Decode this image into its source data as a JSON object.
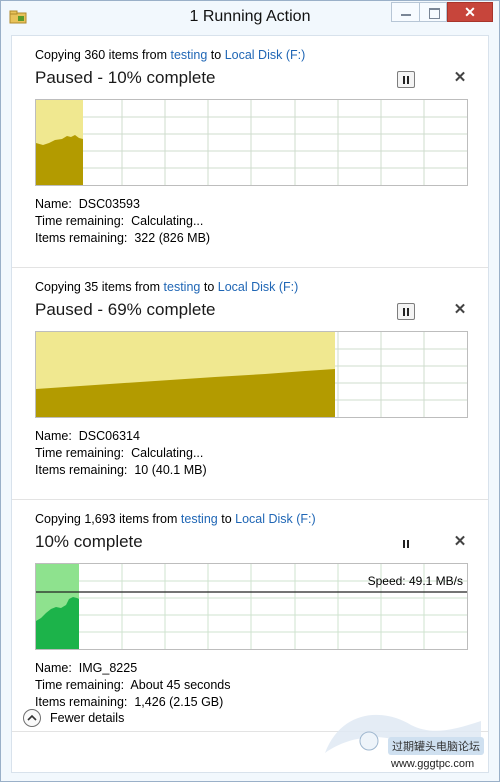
{
  "window": {
    "title": "1 Running Action",
    "close_glyph": "✕"
  },
  "colors": {
    "accent_link": "#1f66b5",
    "paused_fill": "#f0e890",
    "paused_bar": "#b39b00",
    "active_fill": "#8ee28e",
    "active_bar": "#1cb34a",
    "grid": "#cfdcce"
  },
  "operations": [
    {
      "prefix": "Copying 360 items from ",
      "source": "testing",
      "mid": " to ",
      "dest": "Local Disk (F:)",
      "status": "Paused - 10% complete",
      "progress": 0.1,
      "state": "paused",
      "pause_icon": "pause-icon",
      "cancel_glyph": "✕",
      "name_label": "Name:",
      "name_value": "DSC03593",
      "time_label": "Time remaining:",
      "time_value": "Calculating...",
      "items_label": "Items remaining:",
      "items_value": "322 (826 MB)"
    },
    {
      "prefix": "Copying 35 items from ",
      "source": "testing",
      "mid": " to ",
      "dest": "Local Disk (F:)",
      "status": "Paused - 69% complete",
      "progress": 0.69,
      "state": "paused",
      "pause_icon": "pause-icon",
      "cancel_glyph": "✕",
      "name_label": "Name:",
      "name_value": "DSC06314",
      "time_label": "Time remaining:",
      "time_value": "Calculating...",
      "items_label": "Items remaining:",
      "items_value": "10 (40.1 MB)"
    },
    {
      "prefix": "Copying 1,693 items from ",
      "source": "testing",
      "mid": " to ",
      "dest": "Local Disk (F:)",
      "status": "10% complete",
      "progress": 0.1,
      "state": "running",
      "speed": "Speed: 49.1 MB/s",
      "pause_icon": "pause-icon",
      "cancel_glyph": "✕",
      "name_label": "Name:",
      "name_value": "IMG_8225",
      "time_label": "Time remaining:",
      "time_value": "About 45 seconds",
      "items_label": "Items remaining:",
      "items_value": "1,426 (2.15 GB)"
    }
  ],
  "footer": {
    "label": "Fewer details"
  },
  "watermark": {
    "text": "过期罐头电脑论坛",
    "url": "www.gggtpc.com"
  }
}
